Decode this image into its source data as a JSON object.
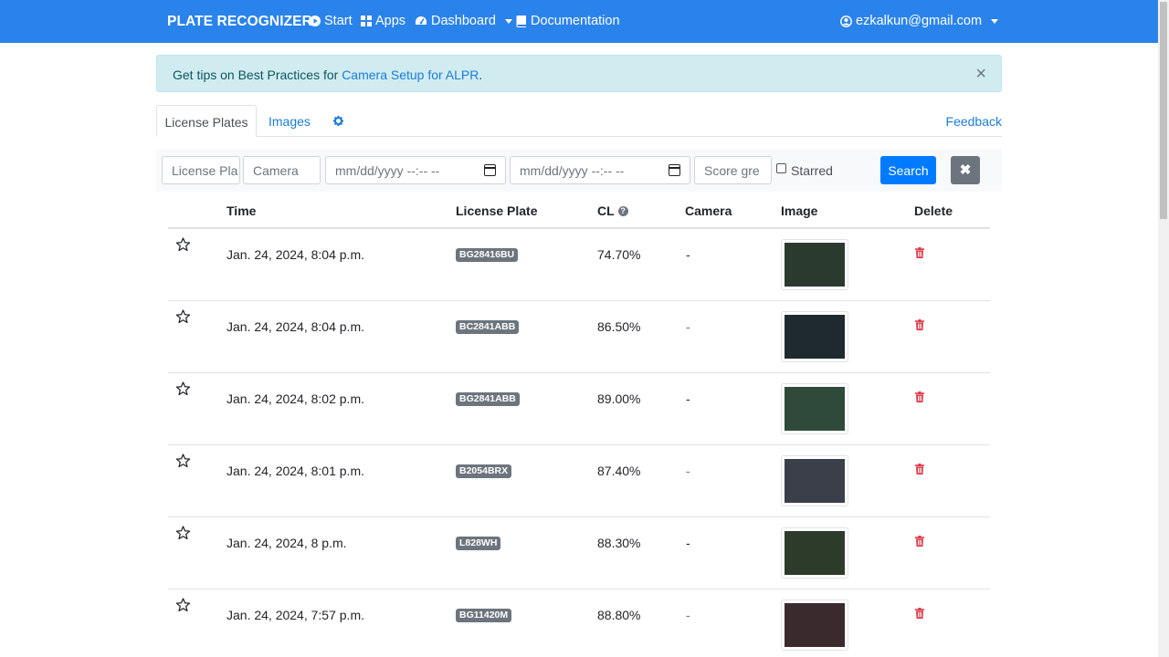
{
  "nav": {
    "brand": "PLATE RECOGNIZER",
    "start": "Start",
    "apps": "Apps",
    "dashboard": "Dashboard",
    "documentation": "Documentation",
    "user": "ezkalkun@gmail.com"
  },
  "alert": {
    "prefix": "Get tips on Best Practices for ",
    "link": "Camera Setup for ALPR",
    "suffix": ".",
    "close": "×"
  },
  "tabs": {
    "license_plates": "License Plates",
    "images": "Images",
    "feedback": "Feedback"
  },
  "filter": {
    "plate_placeholder": "License Pla",
    "camera_placeholder": "Camera",
    "date_from": "mm/dd/yyyy --:-- --",
    "date_to": "mm/dd/yyyy --:-- --",
    "score_placeholder": "Score gre",
    "starred_label": "Starred",
    "search_label": "Search",
    "clear_label": "✖"
  },
  "table": {
    "headers": {
      "time": "Time",
      "plate": "License Plate",
      "cl": "CL",
      "camera": "Camera",
      "image": "Image",
      "delete": "Delete"
    },
    "rows": [
      {
        "time": "Jan. 24, 2024, 8:04 p.m.",
        "plate": "BG28416BU",
        "cl": "74.70%",
        "camera": "-",
        "thumb_color": "#2b3a2e"
      },
      {
        "time": "Jan. 24, 2024, 8:04 p.m.",
        "plate": "BC2841ABB",
        "cl": "86.50%",
        "camera": "-",
        "thumb_color": "#1f2a30"
      },
      {
        "time": "Jan. 24, 2024, 8:02 p.m.",
        "plate": "BG2841ABB",
        "cl": "89.00%",
        "camera": "-",
        "thumb_color": "#2f4a3a"
      },
      {
        "time": "Jan. 24, 2024, 8:01 p.m.",
        "plate": "B2054BRX",
        "cl": "87.40%",
        "camera": "-",
        "thumb_color": "#3a3f4a"
      },
      {
        "time": "Jan. 24, 2024, 8 p.m.",
        "plate": "L828WH",
        "cl": "88.30%",
        "camera": "-",
        "thumb_color": "#2d3b2b"
      },
      {
        "time": "Jan. 24, 2024, 7:57 p.m.",
        "plate": "BG11420M",
        "cl": "88.80%",
        "camera": "-",
        "thumb_color": "#3a2a2e"
      }
    ]
  }
}
